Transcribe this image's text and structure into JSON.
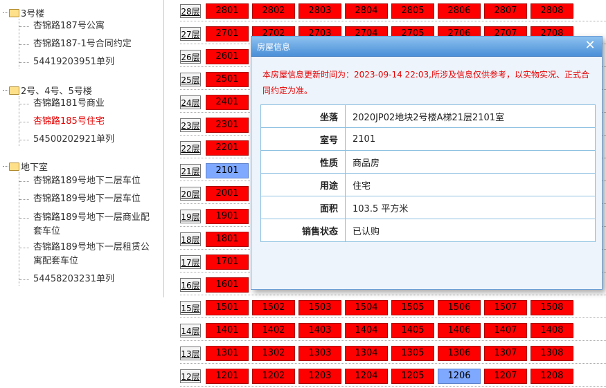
{
  "tree": {
    "groups": [
      {
        "label": "3号楼",
        "items": [
          {
            "label": "杏锦路187号公寓",
            "active": false
          },
          {
            "label": "杏锦路187-1号合同约定",
            "active": false
          },
          {
            "label": "54419203951单列",
            "active": false
          }
        ]
      },
      {
        "label": "2号、4号、5号楼",
        "items": [
          {
            "label": "杏锦路181号商业",
            "active": false
          },
          {
            "label": "杏锦路185号住宅",
            "active": true
          },
          {
            "label": "54500202921单列",
            "active": false
          }
        ]
      },
      {
        "label": "地下室",
        "items": [
          {
            "label": "杏锦路189号地下二层车位",
            "active": false
          },
          {
            "label": "杏锦路189号地下一层车位",
            "active": false
          },
          {
            "label": "杏锦路189号地下一层商业配套车位",
            "lines": [
              "杏锦路189号地下一层商业配",
              "套车位"
            ],
            "active": false
          },
          {
            "label": "杏锦路189号地下一层租赁公寓配套车位",
            "lines": [
              "杏锦路189号地下一层租赁公",
              "寓配套车位"
            ],
            "active": false
          },
          {
            "label": "54458203231单列",
            "active": false
          }
        ]
      }
    ]
  },
  "floors": [
    {
      "label": "28层",
      "units": [
        "2801",
        "2802",
        "2803",
        "2804",
        "2805",
        "2806",
        "2807",
        "2808"
      ]
    },
    {
      "label": "27层",
      "units": [
        "2701",
        "2702",
        "2703",
        "2704",
        "2705",
        "2706",
        "2707",
        "2708"
      ]
    },
    {
      "label": "26层",
      "units": [
        "2601"
      ]
    },
    {
      "label": "25层",
      "units": [
        "2501"
      ]
    },
    {
      "label": "24层",
      "units": [
        "2401"
      ]
    },
    {
      "label": "23层",
      "units": [
        "2301"
      ]
    },
    {
      "label": "22层",
      "units": [
        "2201"
      ]
    },
    {
      "label": "21层",
      "units": [
        "2101"
      ],
      "selected": [
        "2101"
      ]
    },
    {
      "label": "20层",
      "units": [
        "2001"
      ]
    },
    {
      "label": "19层",
      "units": [
        "1901"
      ]
    },
    {
      "label": "18层",
      "units": [
        "1801"
      ]
    },
    {
      "label": "17层",
      "units": [
        "1701"
      ]
    },
    {
      "label": "16层",
      "units": [
        "1601"
      ]
    },
    {
      "label": "15层",
      "units": [
        "1501",
        "1502",
        "1503",
        "1504",
        "1505",
        "1506",
        "1507",
        "1508"
      ]
    },
    {
      "label": "14层",
      "units": [
        "1401",
        "1402",
        "1403",
        "1404",
        "1405",
        "1406",
        "1407",
        "1408"
      ]
    },
    {
      "label": "13层",
      "units": [
        "1301",
        "1302",
        "1303",
        "1304",
        "1305",
        "1306",
        "1307",
        "1308"
      ]
    },
    {
      "label": "12层",
      "units": [
        "1201",
        "1202",
        "1203",
        "1204",
        "1205",
        "1206",
        "1207",
        "1208"
      ],
      "selected": [
        "1206"
      ]
    }
  ],
  "colors": {
    "unit_available": "#ff0000",
    "unit_selected": "#7fa8ff"
  },
  "dialog": {
    "title": "房屋信息",
    "close_icon": "close-icon",
    "notice": "本房屋信息更新时间为：2023-09-14 22:03,所涉及信息仅供参考，以实物实况、正式合同约定为准。",
    "rows": [
      {
        "key": "坐落",
        "value": "2020JP02地块2号楼A梯21层2101室"
      },
      {
        "key": "室号",
        "value": "2101"
      },
      {
        "key": "性质",
        "value": "商品房"
      },
      {
        "key": "用途",
        "value": "住宅"
      },
      {
        "key": "面积",
        "value": "103.5 平方米"
      },
      {
        "key": "销售状态",
        "value": "已认购"
      }
    ]
  }
}
